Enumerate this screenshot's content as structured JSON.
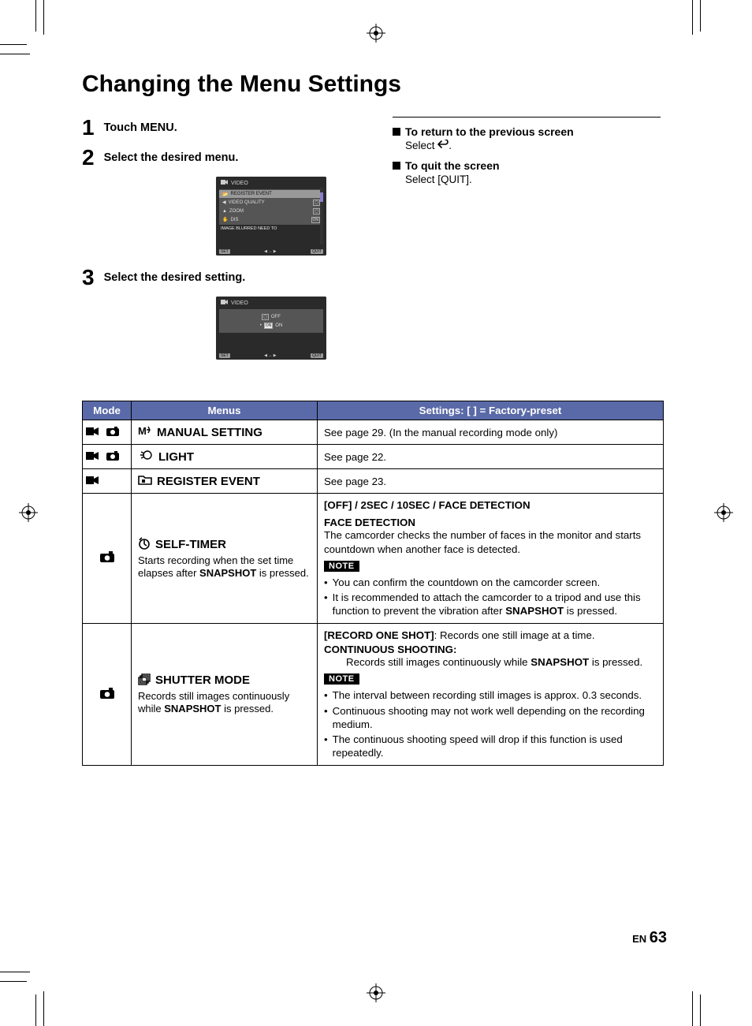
{
  "title": "Changing the Menu Settings",
  "steps": {
    "s1": {
      "num": "1",
      "text": "Touch MENU."
    },
    "s2": {
      "num": "2",
      "text": "Select the desired menu."
    },
    "s3": {
      "num": "3",
      "text": "Select the desired setting."
    }
  },
  "screenshot1": {
    "header": "VIDEO",
    "rows": [
      "REGISTER EVENT",
      "VIDEO QUALITY",
      "ZOOM",
      "DIS"
    ],
    "tags": [
      "",
      "",
      "",
      "ON"
    ],
    "note": "IMAGE BLURRED NEED TO",
    "footer_set": "SET",
    "footer_quit": "QUIT"
  },
  "screenshot2": {
    "header": "VIDEO",
    "opt_off": "OFF",
    "opt_on": "ON",
    "footer_set": "SET",
    "footer_quit": "QUIT"
  },
  "side": {
    "ret_head": "To return to the previous screen",
    "ret_body_a": "Select ",
    "ret_body_b": ".",
    "quit_head": "To quit the screen",
    "quit_body": "Select [QUIT]."
  },
  "table": {
    "head_mode": "Mode",
    "head_menus": "Menus",
    "head_settings": "Settings: [ ] = Factory-preset",
    "rows": {
      "manual": {
        "menu_name": "MANUAL SETTING",
        "settings": "See page 29. (In the manual recording mode only)"
      },
      "light": {
        "menu_name": "LIGHT",
        "settings": "See page 22."
      },
      "regevent": {
        "menu_name": "REGISTER EVENT",
        "settings": "See page 23."
      },
      "selftimer": {
        "menu_name": "SELF-TIMER",
        "menu_desc_a": "Starts recording when the set time elapses after ",
        "menu_desc_b": "SNAPSHOT",
        "menu_desc_c": " is pressed.",
        "settings_head": "[OFF] / 2SEC / 10SEC / FACE DETECTION",
        "fd_title": "FACE DETECTION",
        "fd_body": "The camcorder checks the number of faces in the monitor and starts countdown when another face is detected.",
        "note_label": "NOTE",
        "note1": "You can confirm the countdown on the camcorder screen.",
        "note2_a": "It is recommended to attach the camcorder to a tripod and use this function to prevent the vibration after ",
        "note2_b": "SNAPSHOT",
        "note2_c": " is pressed."
      },
      "shutter": {
        "menu_name": "SHUTTER MODE",
        "menu_desc_a": "Records still images continuously while ",
        "menu_desc_b": "SNAPSHOT",
        "menu_desc_c": " is pressed.",
        "rec_one_a": "[RECORD ONE SHOT]",
        "rec_one_b": ":  Records one still image at a time.",
        "cont_title": "CONTINUOUS SHOOTING",
        "cont_body_a": "Records still images continuously while ",
        "cont_body_b": "SNAPSHOT",
        "cont_body_c": " is pressed.",
        "note_label": "NOTE",
        "n1": "The interval between recording still images is approx. 0.3 seconds.",
        "n2": "Continuous shooting may not work well depending on the recording medium.",
        "n3": "The continuous shooting speed will drop if this function is used repeatedly."
      }
    }
  },
  "page_label_en": "EN",
  "page_number": "63"
}
